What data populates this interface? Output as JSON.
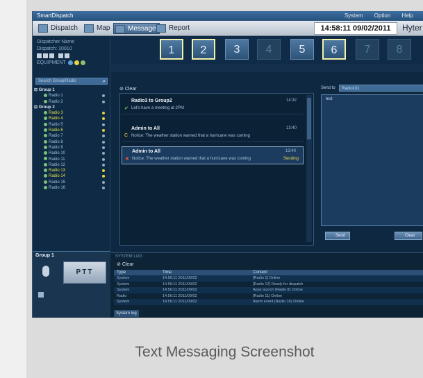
{
  "app": {
    "title": "SmartDispatch",
    "system_menu": [
      "System",
      "Option",
      "Help"
    ]
  },
  "menubar": {
    "buttons": [
      "Dispatch",
      "Map",
      "Message",
      "Report"
    ],
    "active": "Message",
    "clock": "14:58:11 09/02/2011",
    "brand": "Hyter"
  },
  "channels": [
    "1",
    "2",
    "3",
    "4",
    "5",
    "6",
    "7",
    "8"
  ],
  "leftpanel": {
    "user_rows": [
      "Dispatcher Name",
      "Dispatch: 10010"
    ],
    "equipment_label": "EQUIPMENT",
    "search_placeholder": "Search Group/Radio",
    "tree": [
      {
        "label": "Group 1",
        "type": "group"
      },
      {
        "label": "Radio 1",
        "type": "child"
      },
      {
        "label": "Radio 2",
        "type": "child"
      },
      {
        "label": "Group 2",
        "type": "group"
      },
      {
        "label": "Radio 3",
        "type": "child",
        "highlight": true
      },
      {
        "label": "Radio 4",
        "type": "child",
        "highlight": true
      },
      {
        "label": "Radio 5",
        "type": "child"
      },
      {
        "label": "Radio 6",
        "type": "child",
        "highlight": true
      },
      {
        "label": "Radio 7",
        "type": "child"
      },
      {
        "label": "Radio 8",
        "type": "child"
      },
      {
        "label": "Radio 9",
        "type": "child"
      },
      {
        "label": "Radio 10",
        "type": "child"
      },
      {
        "label": "Radio 11",
        "type": "child"
      },
      {
        "label": "Radio 12",
        "type": "child"
      },
      {
        "label": "Radio 13",
        "type": "child",
        "highlight": true
      },
      {
        "label": "Radio 14",
        "type": "child",
        "highlight": true
      },
      {
        "label": "Radio 15",
        "type": "child"
      },
      {
        "label": "Radio 16",
        "type": "child"
      }
    ]
  },
  "ptt": {
    "group": "Group 1",
    "label": "PTT"
  },
  "messages": {
    "clear_label": "Clear",
    "items": [
      {
        "who": "Radio3 to Group2",
        "time": "14:32",
        "text": "Let's have a meeting at 2PM",
        "status": "",
        "mark": "✔",
        "mark_color": "#7ccf6a",
        "selected": false
      },
      {
        "who": "Admin to All",
        "time": "13:40",
        "text": "Notice: The weather station warned that a hurricane was coming",
        "status": "",
        "mark": "C",
        "mark_color": "#f2d14a",
        "selected": false
      },
      {
        "who": "Admin to All",
        "time": "13:40",
        "text": "Notice: The weather station warned that a hurricane was coming",
        "status": "Sending",
        "mark": "✖",
        "mark_color": "#e05040",
        "selected": true
      }
    ]
  },
  "compose": {
    "send_to_label": "Send to",
    "send_to_value": "Radio101",
    "body": "test",
    "buttons": [
      "Send",
      "Clear"
    ]
  },
  "log": {
    "header": "SYSTEM LOG",
    "clear_label": "Clear",
    "columns": [
      "Type",
      "Time",
      "Content"
    ],
    "rows": [
      [
        "System",
        "14:56:11 2011/09/02",
        "[Radio 1] Online"
      ],
      [
        "System",
        "14:56:11 2011/09/02",
        "[Radio 12] Ready for dispatch"
      ],
      [
        "System",
        "14:56:11 2011/09/02",
        "Apps launch (Radio 8) Online"
      ],
      [
        "Radio",
        "14:56:11 2011/09/02",
        "[Radio 11] Online"
      ],
      [
        "System",
        "14:56:11 2011/09/02",
        "Alarm event (Radio 16) Online"
      ]
    ],
    "tab": "System log"
  },
  "caption": "Text Messaging Screenshot"
}
